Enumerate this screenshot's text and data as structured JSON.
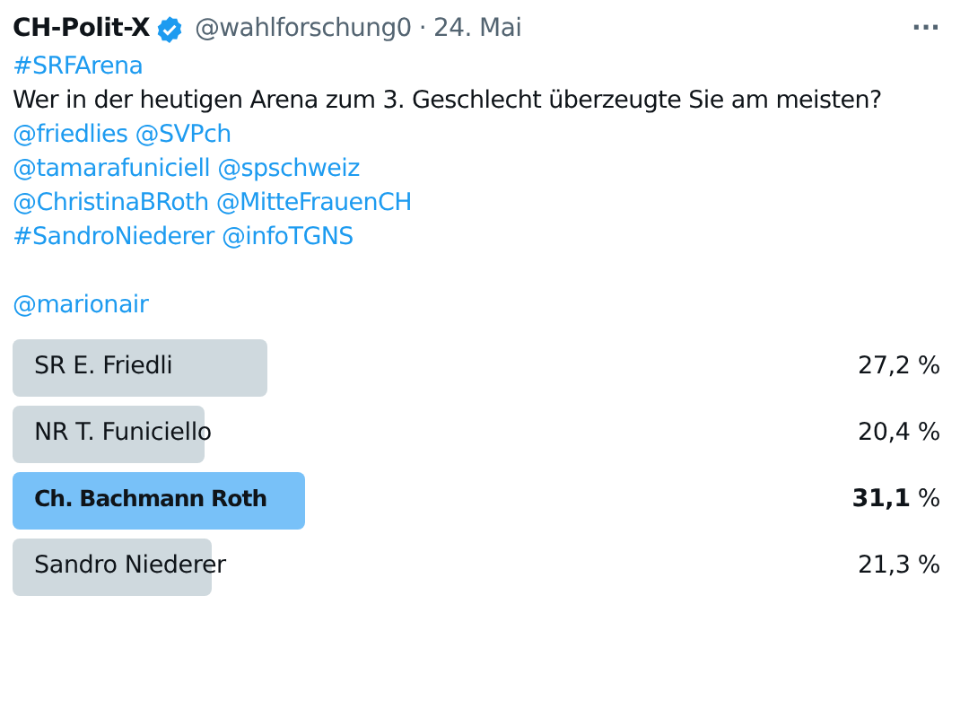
{
  "header": {
    "name": "CH-Polit-X",
    "verified": true,
    "handle": "@wahlforschung0",
    "separator": "·",
    "date": "24. Mai",
    "more": "···"
  },
  "body": [
    {
      "segments": [
        {
          "kind": "link",
          "text": "#SRFArena"
        }
      ]
    },
    {
      "segments": [
        {
          "kind": "text",
          "text": "Wer in der heutigen Arena zum 3. Geschlecht überzeugte Sie am meisten?"
        }
      ]
    },
    {
      "segments": [
        {
          "kind": "link",
          "text": "@friedlies"
        },
        {
          "kind": "link",
          "text": "@SVPch"
        }
      ]
    },
    {
      "segments": [
        {
          "kind": "link",
          "text": "@tamarafuniciell"
        },
        {
          "kind": "link",
          "text": "@spschweiz"
        }
      ]
    },
    {
      "segments": [
        {
          "kind": "link",
          "text": "@ChristinaBRoth"
        },
        {
          "kind": "link",
          "text": "@MitteFrauenCH"
        }
      ]
    },
    {
      "segments": [
        {
          "kind": "link",
          "text": "#SandroNiederer"
        },
        {
          "kind": "link",
          "text": "@infoTGNS"
        }
      ]
    },
    {
      "space_before": true,
      "segments": [
        {
          "kind": "link",
          "text": "@marionair"
        }
      ]
    }
  ],
  "poll": [
    {
      "label": "SR E. Friedli",
      "share": "27,2 %",
      "leading": false
    },
    {
      "label": "NR T. Funiciello",
      "share": "20,4 %",
      "leading": false
    },
    {
      "label": "Ch. Bachmann Roth",
      "share": "**31,1** %",
      "leading": true
    },
    {
      "label": "Sandro Niederer",
      "share": "21,3 %",
      "leading": false
    }
  ]
}
